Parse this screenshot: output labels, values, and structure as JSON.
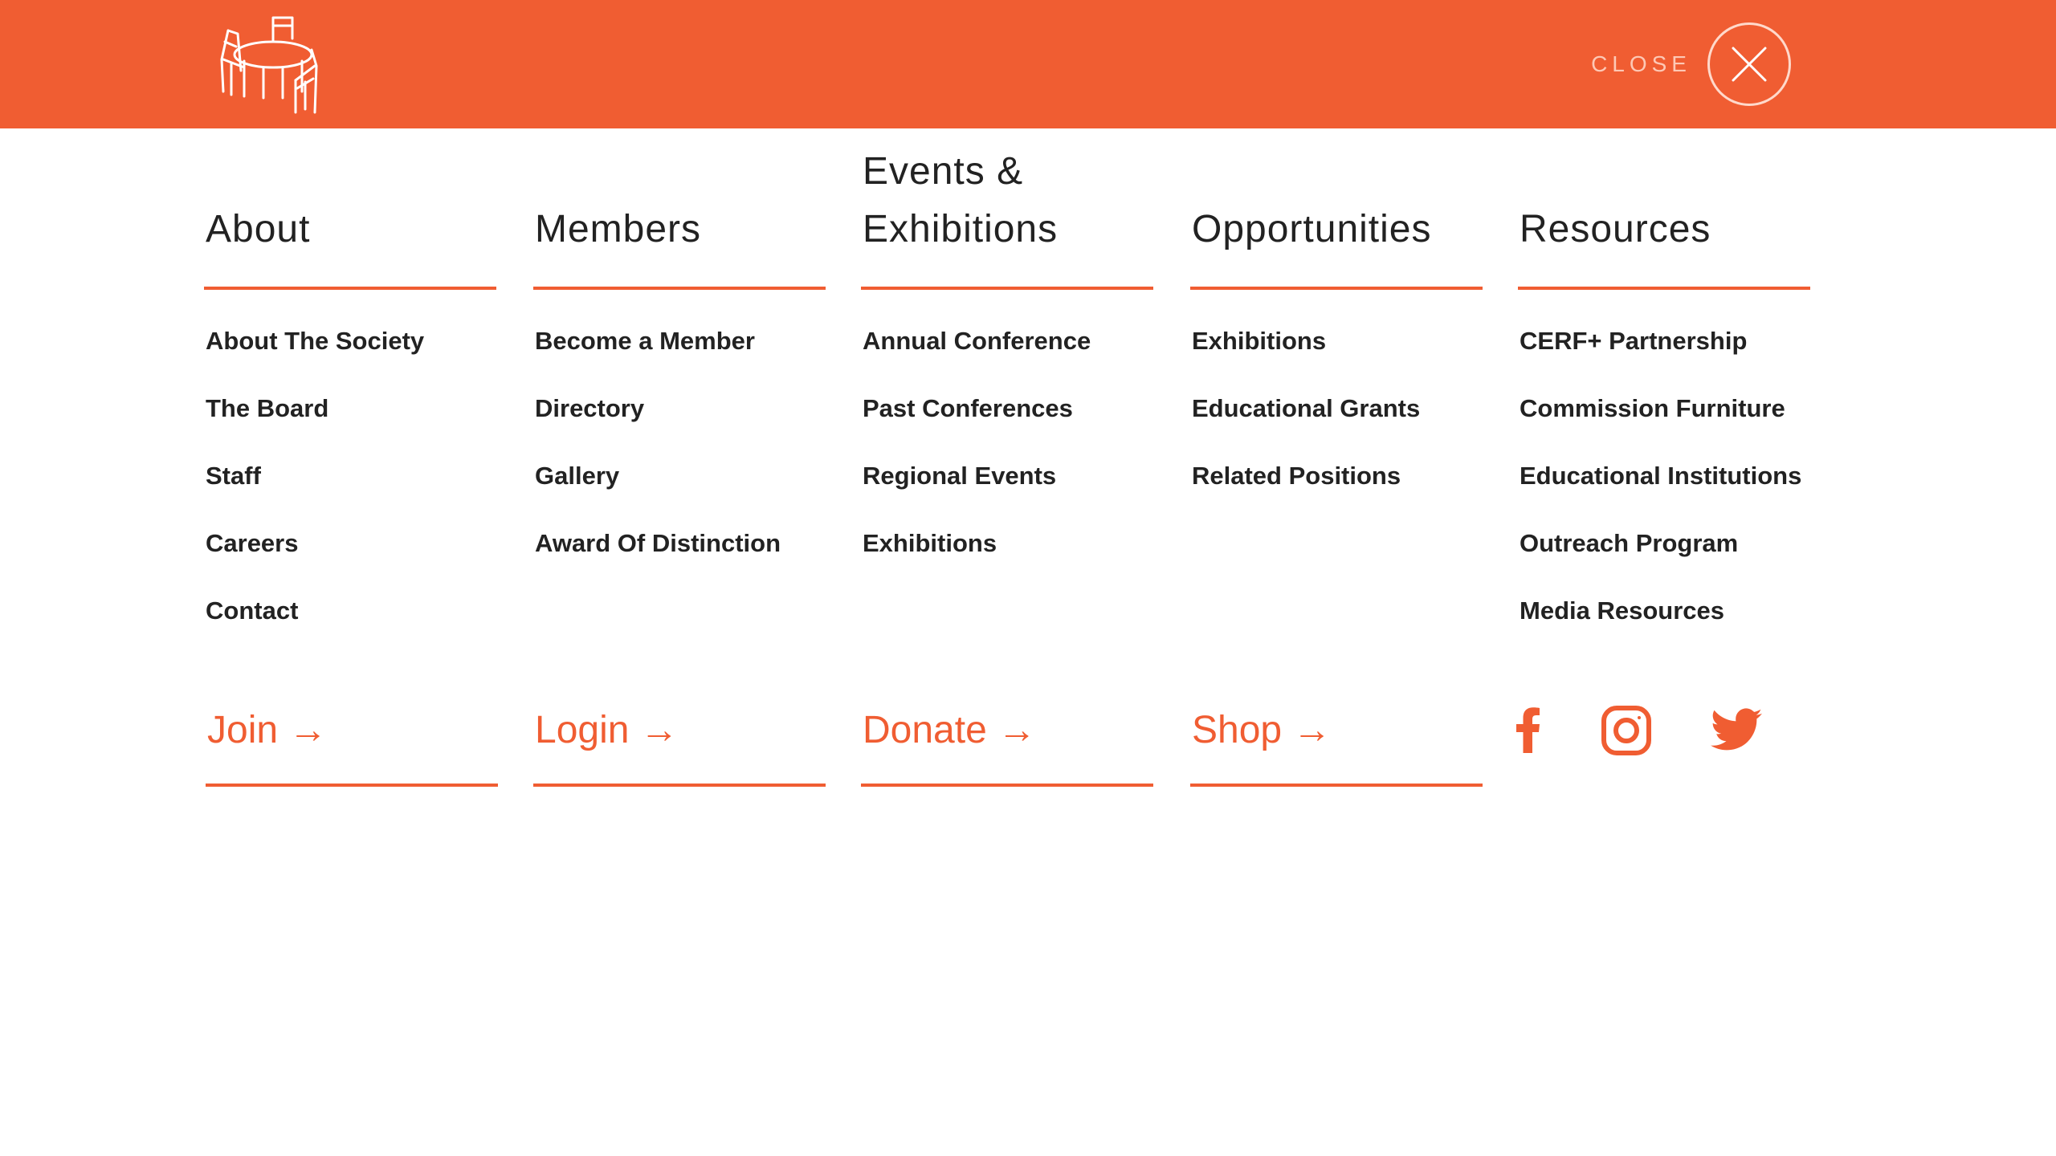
{
  "header": {
    "logo_alt": "table-and-chairs-logo",
    "close_label": "CLOSE"
  },
  "columns": [
    {
      "title": "About",
      "links": [
        "About The Society",
        "The Board",
        "Staff",
        "Careers",
        "Contact"
      ]
    },
    {
      "title": "Members",
      "links": [
        "Become a Member",
        "Directory",
        "Gallery",
        "Award Of Distinction"
      ]
    },
    {
      "title_line1": "Events &",
      "title_line2": "Exhibitions",
      "links": [
        "Annual Conference",
        "Past Conferences",
        "Regional Events",
        "Exhibitions"
      ]
    },
    {
      "title": "Opportunities",
      "links": [
        "Exhibitions",
        "Educational Grants",
        "Related Positions"
      ]
    },
    {
      "title": "Resources",
      "links": [
        "CERF+ Partnership",
        "Commission Furniture",
        "Educational Institutions",
        "Outreach Program",
        "Media Resources"
      ]
    }
  ],
  "actions": [
    {
      "label": "Join →"
    },
    {
      "label": "Login →"
    },
    {
      "label": "Donate →"
    },
    {
      "label": "Shop →"
    }
  ],
  "social": {
    "icons": [
      "facebook-icon",
      "instagram-icon",
      "twitter-icon"
    ]
  },
  "colors": {
    "brand": "#F05D32",
    "text": "#222222",
    "background": "#FFFFFF"
  }
}
